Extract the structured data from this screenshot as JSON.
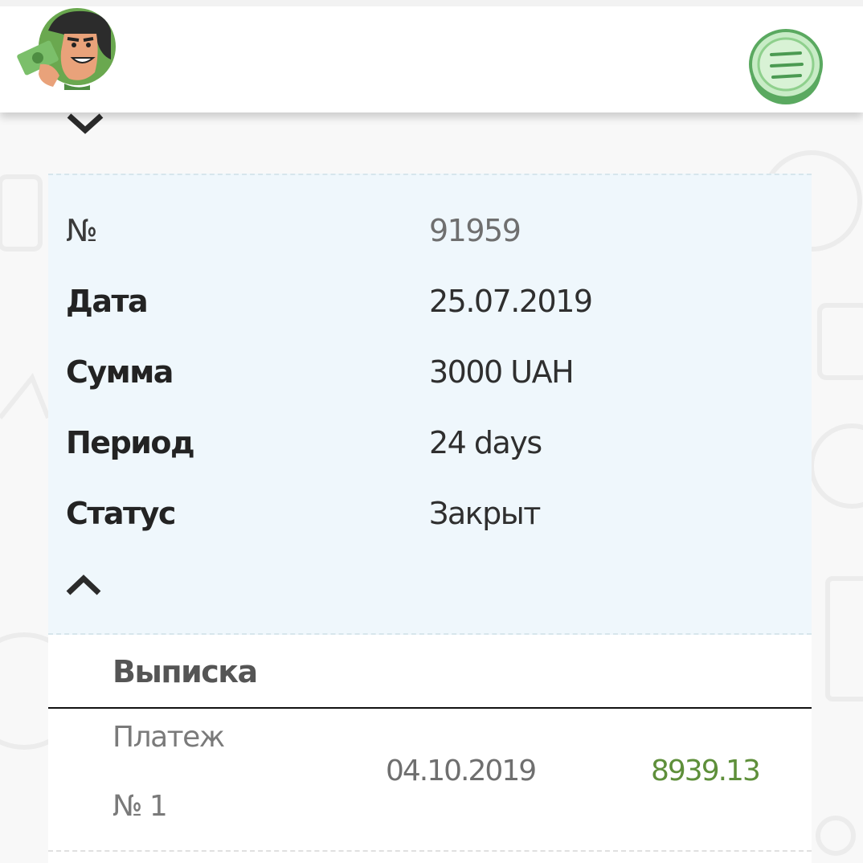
{
  "header": {
    "logo_icon": "money-man-mascot-icon",
    "menu_icon": "hamburger-menu-icon"
  },
  "colors": {
    "accent_green": "#5e8f3a",
    "menu_green": "#6fbf73",
    "panel_background": "#eff7fc"
  },
  "details": {
    "collapse_icon_top": "chevron-down-icon",
    "collapse_icon_bottom": "chevron-up-icon",
    "rows": [
      {
        "label": "№",
        "value": "91959"
      },
      {
        "label": "Дата",
        "value": "25.07.2019"
      },
      {
        "label": "Сумма",
        "value": "3000 UAH"
      },
      {
        "label": "Период",
        "value": "24 days"
      },
      {
        "label": "Статус",
        "value": "Закрыт"
      }
    ]
  },
  "statement": {
    "title": "Выписка",
    "payments": [
      {
        "name_line1": "Платеж",
        "name_line2": "№ 1",
        "date": "04.10.2019",
        "amount": "8939.13"
      }
    ]
  }
}
